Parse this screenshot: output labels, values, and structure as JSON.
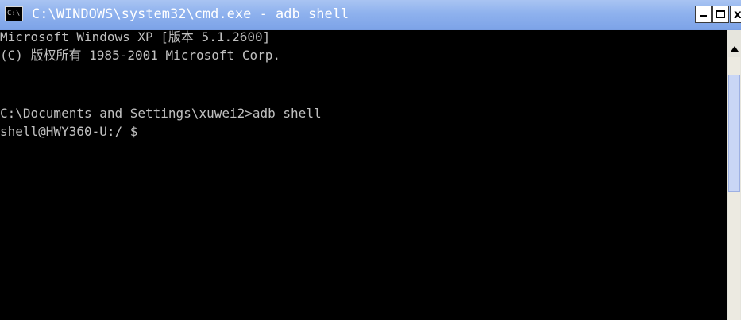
{
  "window": {
    "title": "C:\\WINDOWS\\system32\\cmd.exe - adb shell",
    "icon_text": "C:\\",
    "controls": {
      "minimize_icon": "minimize-icon",
      "maximize_icon": "maximize-icon",
      "close_label": "x"
    }
  },
  "console": {
    "lines": [
      "Microsoft Windows XP [版本 5.1.2600]",
      "(C) 版权所有 1985-2001 Microsoft Corp.",
      "",
      "C:\\Documents and Settings\\xuwei2>adb shell",
      "shell@HWY360-U:/ $"
    ]
  },
  "colors": {
    "titlebar": "#8fb2ee",
    "console_bg": "#000000",
    "console_text": "#c0c0c0"
  }
}
